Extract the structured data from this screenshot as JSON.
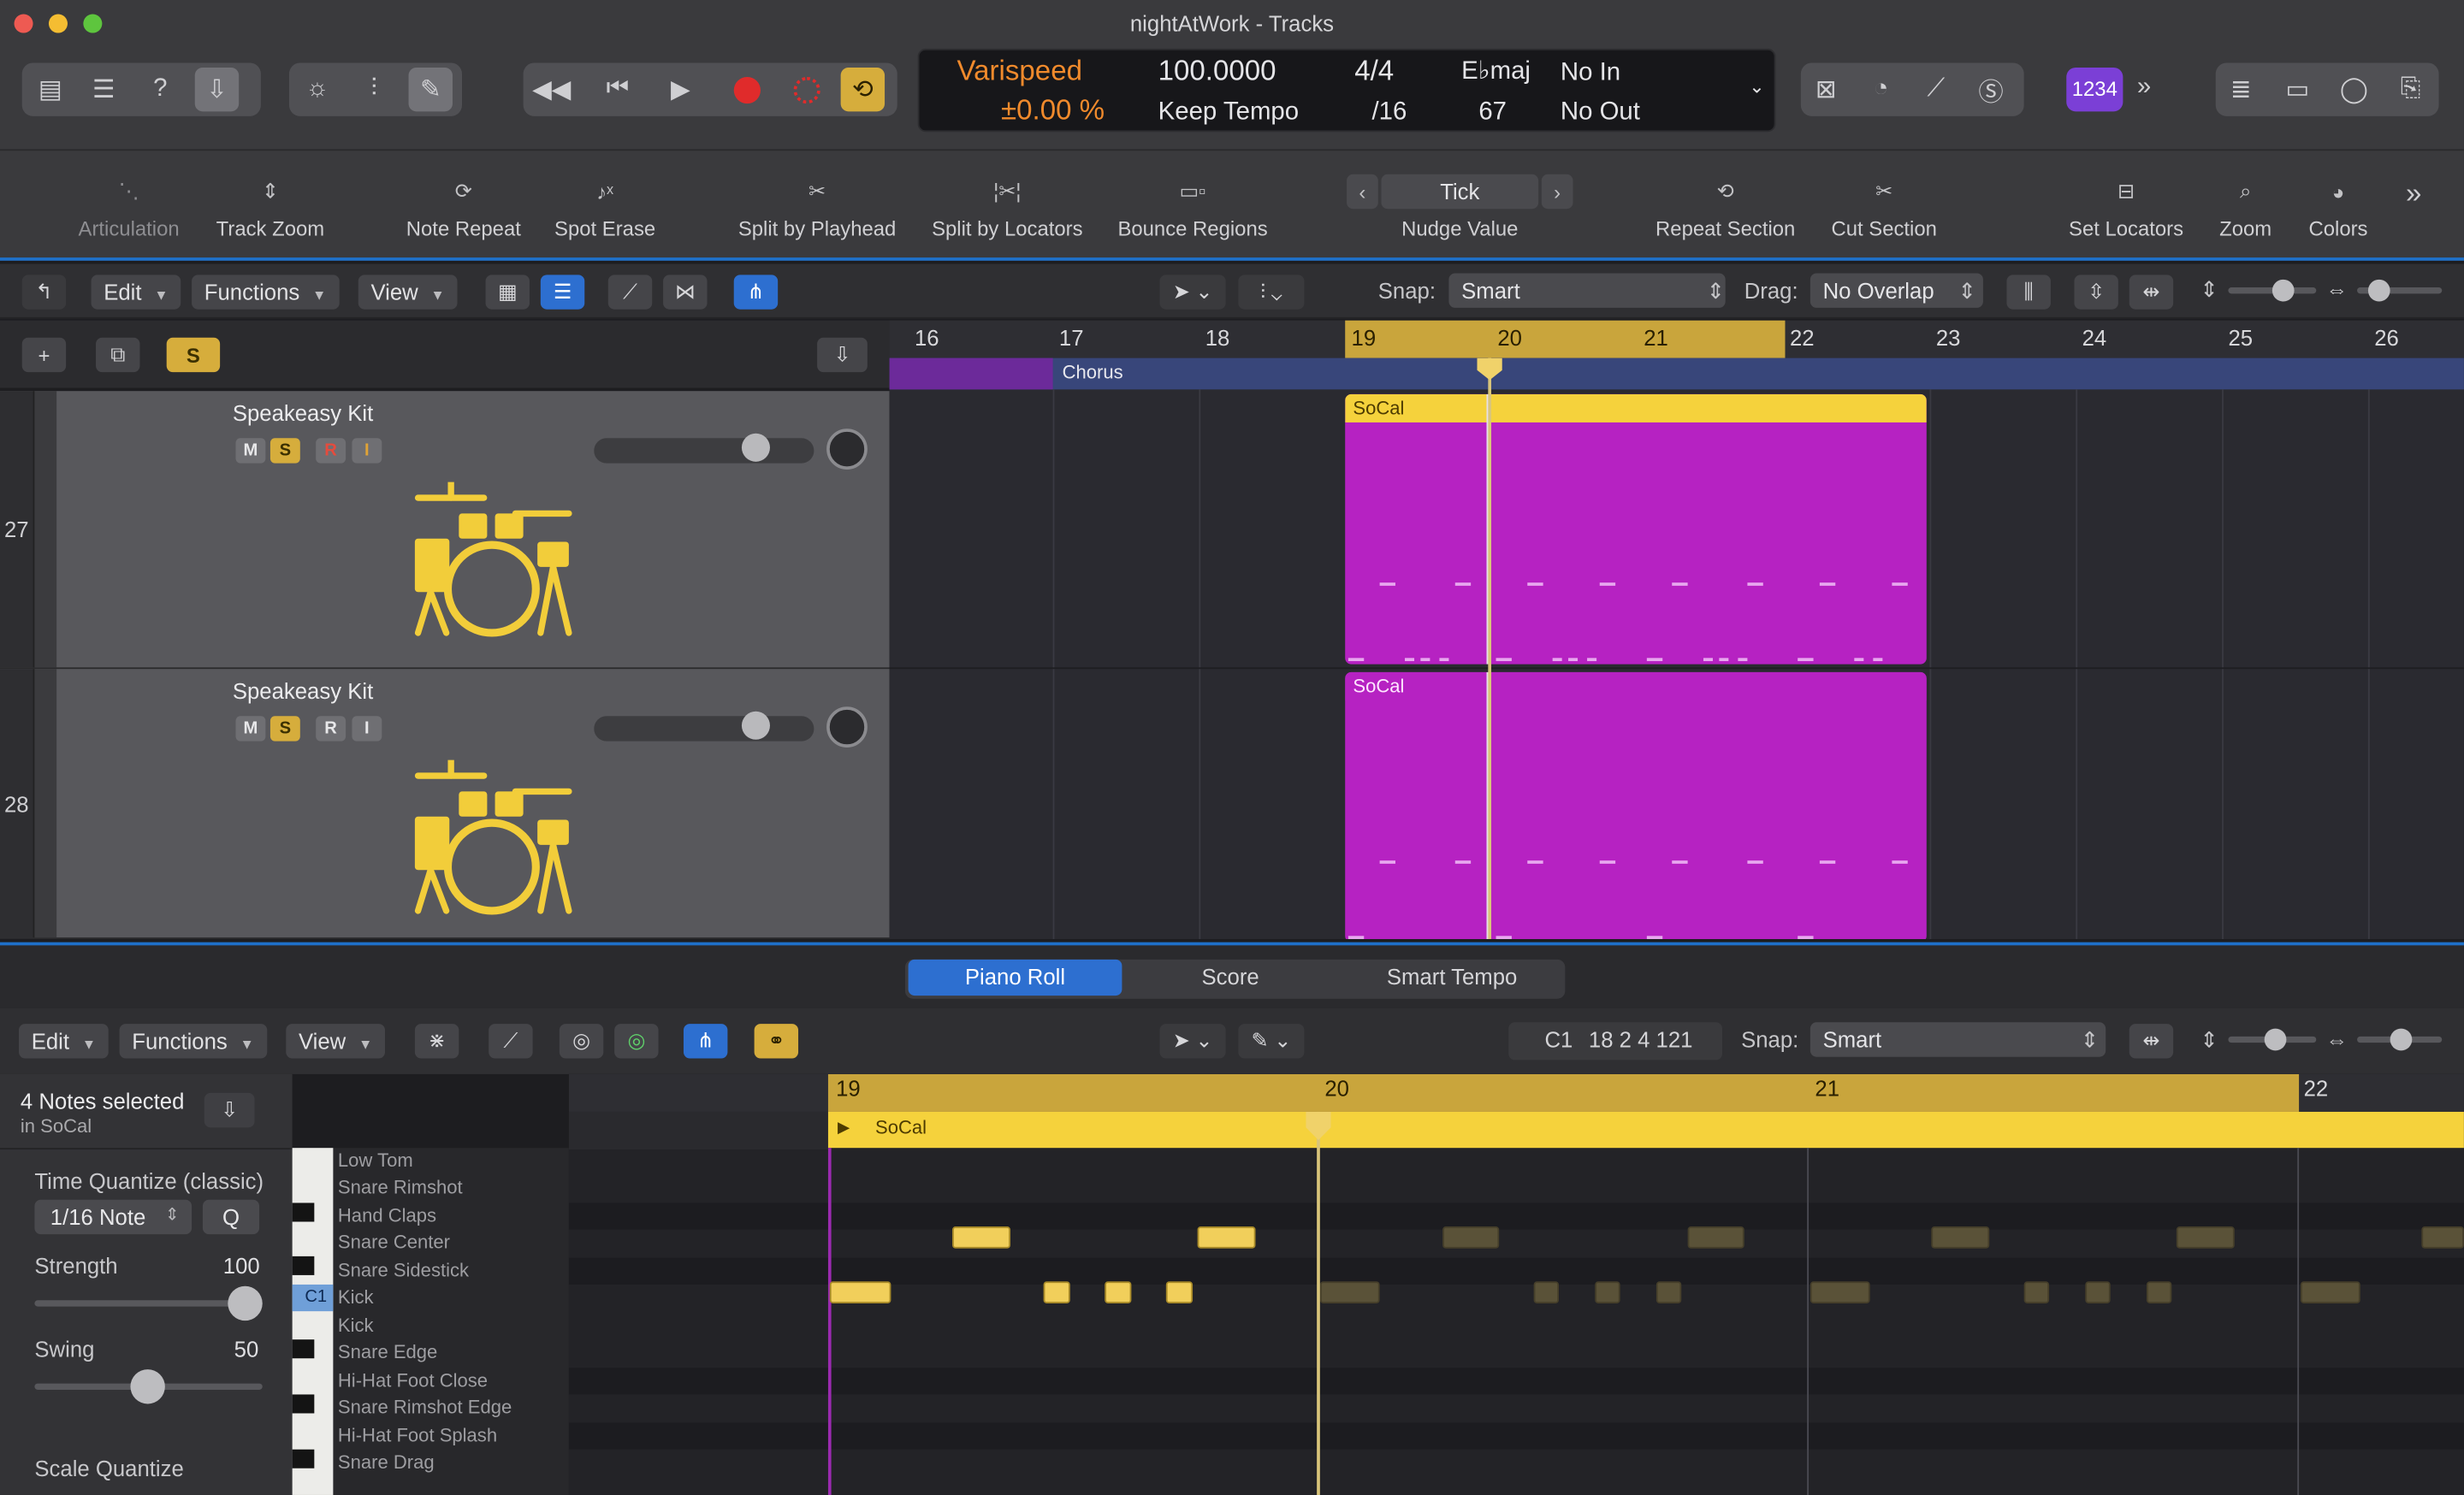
{
  "window": {
    "title": "nightAtWork - Tracks"
  },
  "lcd": {
    "varispeed": "Varispeed",
    "varispeed_value": "±0.00 %",
    "tempo": "100.0000",
    "tempo_mode": "Keep Tempo",
    "signature": "4/4",
    "division": "/16",
    "key": "E♭maj",
    "key_sub": "67",
    "in_point": "No In",
    "out_point": "No Out"
  },
  "count_in_badge": "1234",
  "toolbar": {
    "items": [
      "Articulation",
      "Track Zoom",
      "Note Repeat",
      "Spot Erase",
      "Split by Playhead",
      "Split by Locators",
      "Bounce Regions",
      "Nudge Value",
      "Repeat Section",
      "Cut Section",
      "Set Locators",
      "Zoom",
      "Colors"
    ],
    "nudge_value": "Tick"
  },
  "tracks_bar": {
    "edit": "Edit",
    "functions": "Functions",
    "view": "View",
    "snap_label": "Snap:",
    "snap_value": "Smart",
    "drag_label": "Drag:",
    "drag_value": "No Overlap",
    "solo": "S"
  },
  "ruler": {
    "bars": [
      "16",
      "17",
      "18",
      "19",
      "20",
      "21",
      "22",
      "23",
      "24",
      "25",
      "26"
    ],
    "marker": "Chorus"
  },
  "tracks": [
    {
      "number": "27",
      "name": "Speakeasy Kit",
      "buttons": [
        "M",
        "S",
        "R",
        "I"
      ],
      "region": "SoCal"
    },
    {
      "number": "28",
      "name": "Speakeasy Kit",
      "buttons": [
        "M",
        "S",
        "R",
        "I"
      ],
      "region": "SoCal"
    }
  ],
  "editor": {
    "tabs": [
      "Piano Roll",
      "Score",
      "Smart Tempo"
    ],
    "edit": "Edit",
    "functions": "Functions",
    "view": "View",
    "position_note": "C1",
    "position": "18 2 4 121",
    "snap_label": "Snap:",
    "snap_value": "Smart",
    "selection": "4 Notes selected",
    "selection_region": "in SoCal",
    "time_quantize": "Time Quantize (classic)",
    "quantize_value": "1/16 Note",
    "q_button": "Q",
    "strength_label": "Strength",
    "strength_value": "100",
    "swing_label": "Swing",
    "swing_value": "50",
    "scale_quantize": "Scale Quantize",
    "ruler_bars": [
      "19",
      "20",
      "21",
      "22"
    ],
    "region_name": "SoCal",
    "c1_label": "C1",
    "drum_names": [
      "Low Tom",
      "Snare Rimshot",
      "Hand Claps",
      "Snare Center",
      "Snare Sidestick",
      "Kick",
      "Kick",
      "Snare Edge",
      "Hi-Hat Foot Close",
      "Snare Rimshot Edge",
      "Hi-Hat Foot Splash",
      "Snare Drag"
    ]
  },
  "colors": {
    "region": "#b622c2",
    "region_header": "#f5d23c",
    "accent": "#2d6fd0",
    "record": "#e02b2b",
    "cycle": "#d6ad3c",
    "lcd_orange": "#f08a2c"
  }
}
